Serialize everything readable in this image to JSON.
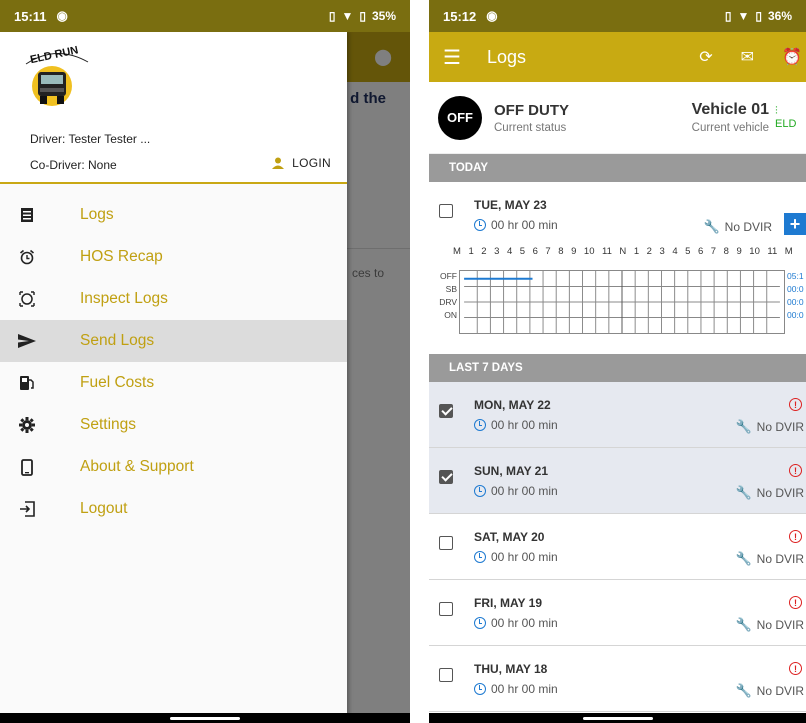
{
  "left": {
    "status": {
      "time": "15:11",
      "battery": "35%"
    },
    "background": {
      "text1": "d the",
      "text2": "ces to"
    },
    "drawer": {
      "driver": "Driver: Tester Tester ...",
      "codriver": "Co-Driver: None",
      "login": "LOGIN",
      "items": [
        {
          "label": "Logs",
          "icon": "list-icon"
        },
        {
          "label": "HOS Recap",
          "icon": "alarm-icon"
        },
        {
          "label": "Inspect Logs",
          "icon": "inspect-icon"
        },
        {
          "label": "Send Logs",
          "icon": "send-icon"
        },
        {
          "label": "Fuel Costs",
          "icon": "fuel-icon"
        },
        {
          "label": "Settings",
          "icon": "gear-icon"
        },
        {
          "label": "About & Support",
          "icon": "phone-icon"
        },
        {
          "label": "Logout",
          "icon": "logout-icon"
        }
      ],
      "selected": "Send Logs"
    }
  },
  "right": {
    "status": {
      "time": "15:12",
      "battery": "36%"
    },
    "toolbar": {
      "title": "Logs"
    },
    "current": {
      "badge": "OFF",
      "status": "OFF DUTY",
      "status_label": "Current status",
      "vehicle": "Vehicle 01",
      "vehicle_label": "Current vehicle",
      "eld": "ELD"
    },
    "today_header": "TODAY",
    "today": {
      "date": "TUE, MAY 23",
      "duration": "00 hr  00 min",
      "dvir": "No DVIR",
      "hours": [
        "M",
        "1",
        "2",
        "3",
        "4",
        "5",
        "6",
        "7",
        "8",
        "9",
        "10",
        "11",
        "N",
        "1",
        "2",
        "3",
        "4",
        "5",
        "6",
        "7",
        "8",
        "9",
        "10",
        "11",
        "M"
      ],
      "rows": [
        "OFF",
        "SB",
        "DRV",
        "ON"
      ],
      "totals": [
        "05:1",
        "00:0",
        "00:0",
        "00:0"
      ]
    },
    "last7_header": "LAST 7 DAYS",
    "days": [
      {
        "date": "MON, MAY 22",
        "duration": "00 hr  00 min",
        "dvir": "No DVIR",
        "checked": true
      },
      {
        "date": "SUN, MAY 21",
        "duration": "00 hr  00 min",
        "dvir": "No DVIR",
        "checked": true
      },
      {
        "date": "SAT, MAY 20",
        "duration": "00 hr  00 min",
        "dvir": "No DVIR",
        "checked": false
      },
      {
        "date": "FRI, MAY 19",
        "duration": "00 hr  00 min",
        "dvir": "No DVIR",
        "checked": false
      },
      {
        "date": "THU, MAY 18",
        "duration": "00 hr  00 min",
        "dvir": "No DVIR",
        "checked": false
      }
    ],
    "off_duty_hours": 5.2
  },
  "colors": {
    "accent": "#c8aa12",
    "statusbar": "#7a6e10",
    "blue": "#1e7ad1",
    "alert": "#d22222"
  }
}
